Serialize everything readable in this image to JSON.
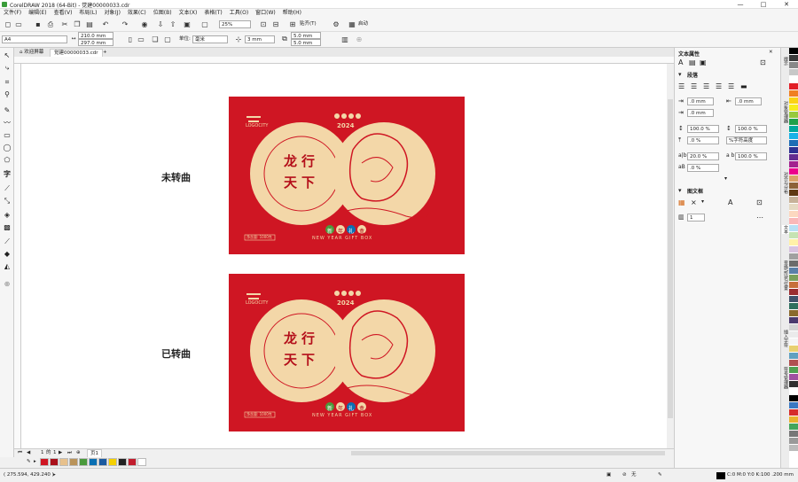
{
  "window": {
    "title": "CorelDRAW 2018 (64-Bit) - 觉建00000033.cdr",
    "min": "—",
    "max": "□",
    "close": "✕"
  },
  "menu": [
    "文件(F)",
    "编辑(E)",
    "查看(V)",
    "布局(L)",
    "对象(J)",
    "效果(C)",
    "位图(B)",
    "文本(X)",
    "表格(T)",
    "工具(O)",
    "窗口(W)",
    "帮助(H)"
  ],
  "toolbar": {
    "zoom": "25%",
    "snap": "贴齐(T)",
    "launch": "启动"
  },
  "propbar": {
    "page_size": "A4",
    "width": "210.0 mm",
    "height": "297.0 mm",
    "unit_label": "单位:",
    "unit": "毫米",
    "nudge": "3 mm",
    "dup_x": "5.0 mm",
    "dup_y": "5.0 mm"
  },
  "tabs": {
    "welcome": "欢迎屏幕",
    "doc": "觉建00000033.cdr",
    "add": "+"
  },
  "canvas": {
    "label_top": "未转曲",
    "label_bottom": "已转曲",
    "card": {
      "logo": "LOGOCITY",
      "year": "2024",
      "chars": [
        "龙",
        "行",
        "天",
        "下"
      ],
      "badges": [
        "新",
        "年",
        "礼",
        "盒"
      ],
      "subtitle": "NEW YEAR GIFT BOX",
      "net": "净含量: 1000克"
    }
  },
  "pages": {
    "current": "1",
    "sep": "的",
    "total": "1",
    "page_tab": "页1"
  },
  "right_panel": {
    "title": "文本属性",
    "section_para": "段落",
    "indent_left": ".0 mm",
    "indent_right": ".0 mm",
    "indent_first": ".0 mm",
    "line_spacing": "100.0 %",
    "para_spacing": "100.0 %",
    "before": ".0 %",
    "spacing_mode": "%字符高度",
    "char_spacing": "20.0 %",
    "word_spacing": "100.0 %",
    "lang_spacing": ".0 %",
    "section_frame": "图文框",
    "columns": "1"
  },
  "dock_tabs": [
    "提示",
    "对象管理器",
    "对齐与分布",
    "文本",
    "变换/形状/位置",
    "插入字符",
    "符号管理器"
  ],
  "status": {
    "coords": "( 275.594, 429.240 )",
    "arrow": "▸",
    "fill": "C:0 M:0 Y:0 K:100  .200 mm",
    "none": "无"
  },
  "colors": {
    "card_red": "#cf1623",
    "cream": "#f3d7a8",
    "accent": "#b40f1a"
  },
  "palette_right": [
    "#000000",
    "#3a3a3a",
    "#888888",
    "#c8c8c8",
    "#ffffff",
    "#e21e26",
    "#f07f21",
    "#fbd214",
    "#f7ec1d",
    "#97c93d",
    "#1fa04a",
    "#00a89d",
    "#1cb2e7",
    "#1e6db5",
    "#2e3192",
    "#652d90",
    "#a3238e",
    "#ec008c",
    "#d9a26a",
    "#8c6239",
    "#603913",
    "#c7b299",
    "#e5d9c2",
    "#fcd8c0",
    "#f9b8b8",
    "#b8e0f5",
    "#c6e3b3",
    "#fff1a8",
    "#d8c3e0",
    "#a0a0a0",
    "#6b6b6b",
    "#5a7fa8",
    "#7ba05b",
    "#c76f3b",
    "#9b2d30",
    "#40526b",
    "#2f6f5e",
    "#8a6a2d",
    "#4b3a6e",
    "#d4d4d4",
    "#ebebeb",
    "#f5f5f5",
    "#e8d070",
    "#60a0c0",
    "#b05050",
    "#50a050",
    "#a050a0",
    "#303030",
    "#ffffff",
    "#000000",
    "#3a78c2",
    "#d62c2c",
    "#e9b22f",
    "#44a55c",
    "#777777",
    "#999999",
    "#bbbbbb"
  ],
  "palette_bottom": [
    "#cf1623",
    "#a90f1a",
    "#e7c18d",
    "#b9935a",
    "#4a9a3c",
    "#0a6fb3",
    "#1b5aa0",
    "#f5d000",
    "#222222",
    "#c21d2d",
    "#ffffff"
  ]
}
